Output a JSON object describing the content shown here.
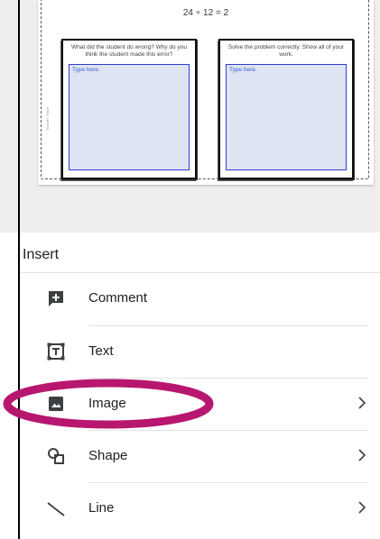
{
  "slide": {
    "equation": "24 ÷ 12 = 2",
    "cards": [
      {
        "question": "What did the student do wrong? Why do you think the student made this error?",
        "placeholder": "Type here."
      },
      {
        "question": "Solve the problem correctly. Show all of your work.",
        "placeholder": "Type here."
      }
    ],
    "watermark": "Teacher Thrive"
  },
  "menu": {
    "title": "Insert",
    "items": [
      {
        "label": "Comment",
        "icon": "add-comment-icon",
        "has_submenu": false
      },
      {
        "label": "Text",
        "icon": "text-box-icon",
        "has_submenu": false
      },
      {
        "label": "Image",
        "icon": "image-icon",
        "has_submenu": true
      },
      {
        "label": "Shape",
        "icon": "shape-icon",
        "has_submenu": true
      },
      {
        "label": "Line",
        "icon": "line-icon",
        "has_submenu": true
      }
    ]
  },
  "annotation": {
    "highlighted_item": "Image",
    "color": "#b8176f"
  },
  "colors": {
    "icon": "#3c4043",
    "divider": "#e3e3e3",
    "input_fill": "#dfe4f3",
    "input_border": "#2b3fd8"
  }
}
